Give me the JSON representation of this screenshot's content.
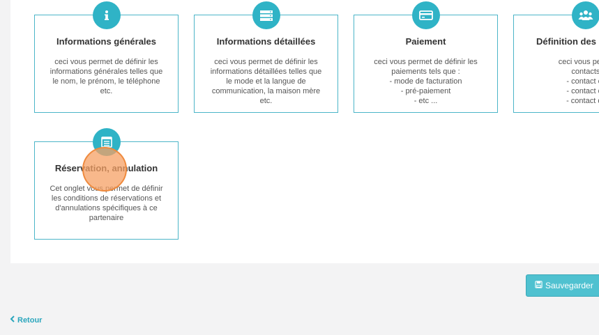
{
  "cards": [
    {
      "title": "Informations générales",
      "description": "ceci vous permet de définir les\ninformations générales telles que\nle nom, le prénom, le téléphone\netc.",
      "icon": "info-icon"
    },
    {
      "title": "Informations détaillées",
      "description": "ceci vous permet de définir les\ninformations détaillées telles que\nle mode et la langue de\ncommunication, la maison mère\netc.",
      "icon": "server-icon"
    },
    {
      "title": "Paiement",
      "description": "ceci vous permet de définir les\npaiements tels que :\n- mode de facturation\n- pré-paiement\n- etc ...",
      "icon": "credit-card-icon"
    },
    {
      "title": "Définition des",
      "description": "ceci vous permet de\ncontacts tels\n- contact comm\n- contact de fac\n- contact de rés",
      "icon": "users-icon"
    },
    {
      "title": "Réservation, annulation",
      "description": "Cet onglet vous permet de définir\nles conditions de réservations et\nd'annulations spécifiques à ce\npartenaire",
      "icon": "list-icon"
    }
  ],
  "footer": {
    "save_label": "Sauvegarder",
    "back_label": "Retour"
  },
  "colors": {
    "accent": "#2fb3c6",
    "button": "#4fc1d0",
    "click_marker": "#f5a064"
  }
}
